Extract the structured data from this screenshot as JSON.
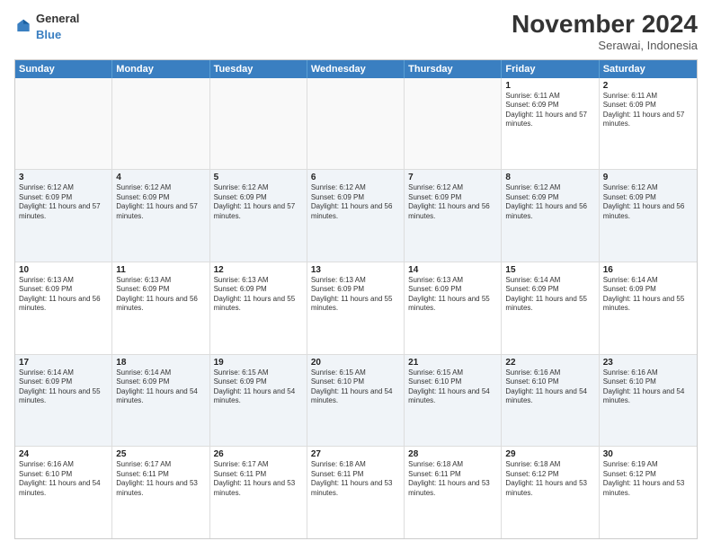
{
  "header": {
    "logo": {
      "text_general": "General",
      "text_blue": "Blue"
    },
    "title": "November 2024",
    "location": "Serawai, Indonesia"
  },
  "calendar": {
    "days_of_week": [
      "Sunday",
      "Monday",
      "Tuesday",
      "Wednesday",
      "Thursday",
      "Friday",
      "Saturday"
    ],
    "weeks": [
      [
        {
          "day": "",
          "content": ""
        },
        {
          "day": "",
          "content": ""
        },
        {
          "day": "",
          "content": ""
        },
        {
          "day": "",
          "content": ""
        },
        {
          "day": "",
          "content": ""
        },
        {
          "day": "1",
          "content": "Sunrise: 6:11 AM\nSunset: 6:09 PM\nDaylight: 11 hours and 57 minutes."
        },
        {
          "day": "2",
          "content": "Sunrise: 6:11 AM\nSunset: 6:09 PM\nDaylight: 11 hours and 57 minutes."
        }
      ],
      [
        {
          "day": "3",
          "content": "Sunrise: 6:12 AM\nSunset: 6:09 PM\nDaylight: 11 hours and 57 minutes."
        },
        {
          "day": "4",
          "content": "Sunrise: 6:12 AM\nSunset: 6:09 PM\nDaylight: 11 hours and 57 minutes."
        },
        {
          "day": "5",
          "content": "Sunrise: 6:12 AM\nSunset: 6:09 PM\nDaylight: 11 hours and 57 minutes."
        },
        {
          "day": "6",
          "content": "Sunrise: 6:12 AM\nSunset: 6:09 PM\nDaylight: 11 hours and 56 minutes."
        },
        {
          "day": "7",
          "content": "Sunrise: 6:12 AM\nSunset: 6:09 PM\nDaylight: 11 hours and 56 minutes."
        },
        {
          "day": "8",
          "content": "Sunrise: 6:12 AM\nSunset: 6:09 PM\nDaylight: 11 hours and 56 minutes."
        },
        {
          "day": "9",
          "content": "Sunrise: 6:12 AM\nSunset: 6:09 PM\nDaylight: 11 hours and 56 minutes."
        }
      ],
      [
        {
          "day": "10",
          "content": "Sunrise: 6:13 AM\nSunset: 6:09 PM\nDaylight: 11 hours and 56 minutes."
        },
        {
          "day": "11",
          "content": "Sunrise: 6:13 AM\nSunset: 6:09 PM\nDaylight: 11 hours and 56 minutes."
        },
        {
          "day": "12",
          "content": "Sunrise: 6:13 AM\nSunset: 6:09 PM\nDaylight: 11 hours and 55 minutes."
        },
        {
          "day": "13",
          "content": "Sunrise: 6:13 AM\nSunset: 6:09 PM\nDaylight: 11 hours and 55 minutes."
        },
        {
          "day": "14",
          "content": "Sunrise: 6:13 AM\nSunset: 6:09 PM\nDaylight: 11 hours and 55 minutes."
        },
        {
          "day": "15",
          "content": "Sunrise: 6:14 AM\nSunset: 6:09 PM\nDaylight: 11 hours and 55 minutes."
        },
        {
          "day": "16",
          "content": "Sunrise: 6:14 AM\nSunset: 6:09 PM\nDaylight: 11 hours and 55 minutes."
        }
      ],
      [
        {
          "day": "17",
          "content": "Sunrise: 6:14 AM\nSunset: 6:09 PM\nDaylight: 11 hours and 55 minutes."
        },
        {
          "day": "18",
          "content": "Sunrise: 6:14 AM\nSunset: 6:09 PM\nDaylight: 11 hours and 54 minutes."
        },
        {
          "day": "19",
          "content": "Sunrise: 6:15 AM\nSunset: 6:09 PM\nDaylight: 11 hours and 54 minutes."
        },
        {
          "day": "20",
          "content": "Sunrise: 6:15 AM\nSunset: 6:10 PM\nDaylight: 11 hours and 54 minutes."
        },
        {
          "day": "21",
          "content": "Sunrise: 6:15 AM\nSunset: 6:10 PM\nDaylight: 11 hours and 54 minutes."
        },
        {
          "day": "22",
          "content": "Sunrise: 6:16 AM\nSunset: 6:10 PM\nDaylight: 11 hours and 54 minutes."
        },
        {
          "day": "23",
          "content": "Sunrise: 6:16 AM\nSunset: 6:10 PM\nDaylight: 11 hours and 54 minutes."
        }
      ],
      [
        {
          "day": "24",
          "content": "Sunrise: 6:16 AM\nSunset: 6:10 PM\nDaylight: 11 hours and 54 minutes."
        },
        {
          "day": "25",
          "content": "Sunrise: 6:17 AM\nSunset: 6:11 PM\nDaylight: 11 hours and 53 minutes."
        },
        {
          "day": "26",
          "content": "Sunrise: 6:17 AM\nSunset: 6:11 PM\nDaylight: 11 hours and 53 minutes."
        },
        {
          "day": "27",
          "content": "Sunrise: 6:18 AM\nSunset: 6:11 PM\nDaylight: 11 hours and 53 minutes."
        },
        {
          "day": "28",
          "content": "Sunrise: 6:18 AM\nSunset: 6:11 PM\nDaylight: 11 hours and 53 minutes."
        },
        {
          "day": "29",
          "content": "Sunrise: 6:18 AM\nSunset: 6:12 PM\nDaylight: 11 hours and 53 minutes."
        },
        {
          "day": "30",
          "content": "Sunrise: 6:19 AM\nSunset: 6:12 PM\nDaylight: 11 hours and 53 minutes."
        }
      ]
    ]
  }
}
